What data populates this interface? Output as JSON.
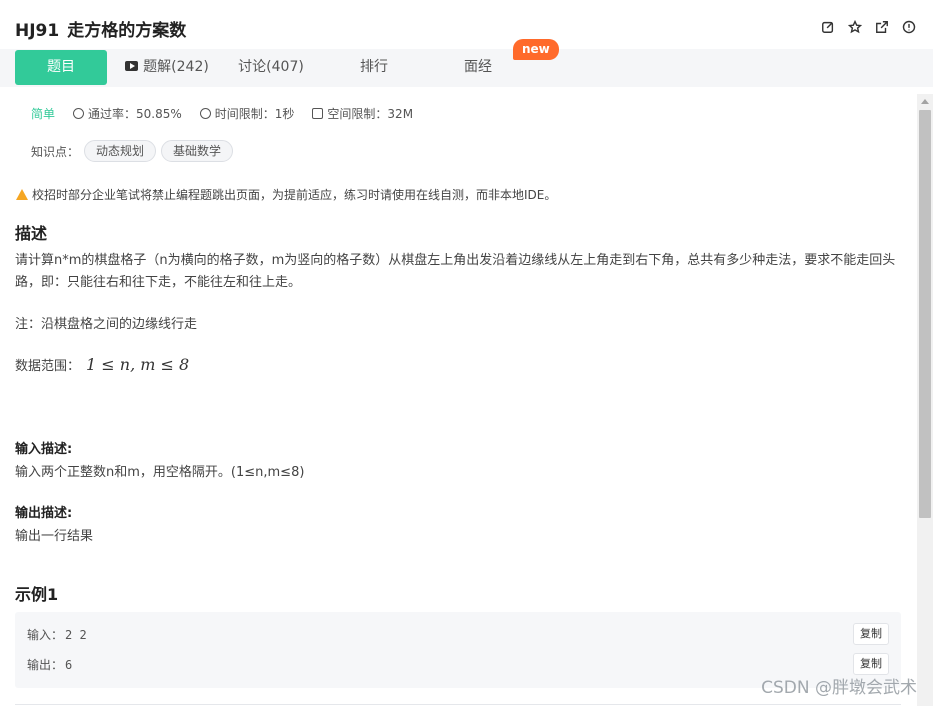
{
  "header": {
    "problem_id": "HJ91",
    "problem_title": "走方格的方案数",
    "icons": [
      "edit-icon",
      "star-icon",
      "share-icon",
      "info-icon"
    ]
  },
  "tabs": [
    {
      "label": "题目",
      "active": true
    },
    {
      "label": "题解(242)",
      "active": false
    },
    {
      "label": "讨论(407)",
      "active": false
    },
    {
      "label": "排行",
      "active": false
    },
    {
      "label": "面经",
      "active": false
    }
  ],
  "new_badge": "new",
  "meta": {
    "difficulty": "简单",
    "pass_rate": "通过率：50.85%",
    "time_limit": "时间限制：1秒",
    "memory_limit": "空间限制：32M"
  },
  "knowledge": {
    "label": "知识点：",
    "tags": [
      "动态规划",
      "基础数学"
    ]
  },
  "warning": "校招时部分企业笔试将禁止编程题跳出页面，为提前适应，练习时请使用在线自测，而非本地IDE。",
  "description": {
    "heading": "描述",
    "paragraph1": "请计算n*m的棋盘格子（n为横向的格子数，m为竖向的格子数）从棋盘左上角出发沿着边缘线从左上角走到右下角，总共有多少种走法，要求不能走回头路，即：只能往右和往下走，不能往左和往上走。",
    "note": "注：沿棋盘格之间的边缘线行走",
    "range_label": "数据范围：",
    "range_formula": "1 ≤ n, m ≤ 8"
  },
  "input_desc": {
    "heading": "输入描述:",
    "text": "输入两个正整数n和m，用空格隔开。(1≤n,m≤8)"
  },
  "output_desc": {
    "heading": "输出描述:",
    "text": "输出一行结果"
  },
  "example": {
    "heading": "示例1",
    "input_label": "输入：",
    "input_value": "2 2",
    "output_label": "输出：",
    "output_value": "6",
    "copy_label": "复制"
  },
  "watermark": "CSDN @胖墩会武术",
  "colors": {
    "accent": "#32ca99",
    "new_badge": "#ff6a2b",
    "warning": "#f5a623"
  }
}
